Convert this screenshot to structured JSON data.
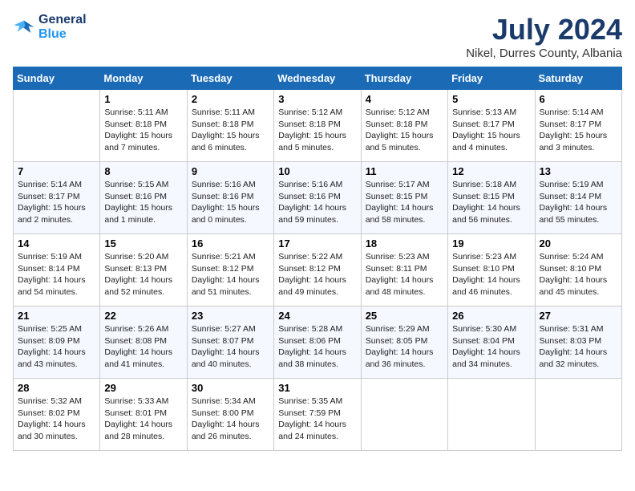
{
  "header": {
    "logo_line1": "General",
    "logo_line2": "Blue",
    "month": "July 2024",
    "location": "Nikel, Durres County, Albania"
  },
  "weekdays": [
    "Sunday",
    "Monday",
    "Tuesday",
    "Wednesday",
    "Thursday",
    "Friday",
    "Saturday"
  ],
  "weeks": [
    [
      {
        "day": "",
        "info": ""
      },
      {
        "day": "1",
        "info": "Sunrise: 5:11 AM\nSunset: 8:18 PM\nDaylight: 15 hours\nand 7 minutes."
      },
      {
        "day": "2",
        "info": "Sunrise: 5:11 AM\nSunset: 8:18 PM\nDaylight: 15 hours\nand 6 minutes."
      },
      {
        "day": "3",
        "info": "Sunrise: 5:12 AM\nSunset: 8:18 PM\nDaylight: 15 hours\nand 5 minutes."
      },
      {
        "day": "4",
        "info": "Sunrise: 5:12 AM\nSunset: 8:18 PM\nDaylight: 15 hours\nand 5 minutes."
      },
      {
        "day": "5",
        "info": "Sunrise: 5:13 AM\nSunset: 8:17 PM\nDaylight: 15 hours\nand 4 minutes."
      },
      {
        "day": "6",
        "info": "Sunrise: 5:14 AM\nSunset: 8:17 PM\nDaylight: 15 hours\nand 3 minutes."
      }
    ],
    [
      {
        "day": "7",
        "info": "Sunrise: 5:14 AM\nSunset: 8:17 PM\nDaylight: 15 hours\nand 2 minutes."
      },
      {
        "day": "8",
        "info": "Sunrise: 5:15 AM\nSunset: 8:16 PM\nDaylight: 15 hours\nand 1 minute."
      },
      {
        "day": "9",
        "info": "Sunrise: 5:16 AM\nSunset: 8:16 PM\nDaylight: 15 hours\nand 0 minutes."
      },
      {
        "day": "10",
        "info": "Sunrise: 5:16 AM\nSunset: 8:16 PM\nDaylight: 14 hours\nand 59 minutes."
      },
      {
        "day": "11",
        "info": "Sunrise: 5:17 AM\nSunset: 8:15 PM\nDaylight: 14 hours\nand 58 minutes."
      },
      {
        "day": "12",
        "info": "Sunrise: 5:18 AM\nSunset: 8:15 PM\nDaylight: 14 hours\nand 56 minutes."
      },
      {
        "day": "13",
        "info": "Sunrise: 5:19 AM\nSunset: 8:14 PM\nDaylight: 14 hours\nand 55 minutes."
      }
    ],
    [
      {
        "day": "14",
        "info": "Sunrise: 5:19 AM\nSunset: 8:14 PM\nDaylight: 14 hours\nand 54 minutes."
      },
      {
        "day": "15",
        "info": "Sunrise: 5:20 AM\nSunset: 8:13 PM\nDaylight: 14 hours\nand 52 minutes."
      },
      {
        "day": "16",
        "info": "Sunrise: 5:21 AM\nSunset: 8:12 PM\nDaylight: 14 hours\nand 51 minutes."
      },
      {
        "day": "17",
        "info": "Sunrise: 5:22 AM\nSunset: 8:12 PM\nDaylight: 14 hours\nand 49 minutes."
      },
      {
        "day": "18",
        "info": "Sunrise: 5:23 AM\nSunset: 8:11 PM\nDaylight: 14 hours\nand 48 minutes."
      },
      {
        "day": "19",
        "info": "Sunrise: 5:23 AM\nSunset: 8:10 PM\nDaylight: 14 hours\nand 46 minutes."
      },
      {
        "day": "20",
        "info": "Sunrise: 5:24 AM\nSunset: 8:10 PM\nDaylight: 14 hours\nand 45 minutes."
      }
    ],
    [
      {
        "day": "21",
        "info": "Sunrise: 5:25 AM\nSunset: 8:09 PM\nDaylight: 14 hours\nand 43 minutes."
      },
      {
        "day": "22",
        "info": "Sunrise: 5:26 AM\nSunset: 8:08 PM\nDaylight: 14 hours\nand 41 minutes."
      },
      {
        "day": "23",
        "info": "Sunrise: 5:27 AM\nSunset: 8:07 PM\nDaylight: 14 hours\nand 40 minutes."
      },
      {
        "day": "24",
        "info": "Sunrise: 5:28 AM\nSunset: 8:06 PM\nDaylight: 14 hours\nand 38 minutes."
      },
      {
        "day": "25",
        "info": "Sunrise: 5:29 AM\nSunset: 8:05 PM\nDaylight: 14 hours\nand 36 minutes."
      },
      {
        "day": "26",
        "info": "Sunrise: 5:30 AM\nSunset: 8:04 PM\nDaylight: 14 hours\nand 34 minutes."
      },
      {
        "day": "27",
        "info": "Sunrise: 5:31 AM\nSunset: 8:03 PM\nDaylight: 14 hours\nand 32 minutes."
      }
    ],
    [
      {
        "day": "28",
        "info": "Sunrise: 5:32 AM\nSunset: 8:02 PM\nDaylight: 14 hours\nand 30 minutes."
      },
      {
        "day": "29",
        "info": "Sunrise: 5:33 AM\nSunset: 8:01 PM\nDaylight: 14 hours\nand 28 minutes."
      },
      {
        "day": "30",
        "info": "Sunrise: 5:34 AM\nSunset: 8:00 PM\nDaylight: 14 hours\nand 26 minutes."
      },
      {
        "day": "31",
        "info": "Sunrise: 5:35 AM\nSunset: 7:59 PM\nDaylight: 14 hours\nand 24 minutes."
      },
      {
        "day": "",
        "info": ""
      },
      {
        "day": "",
        "info": ""
      },
      {
        "day": "",
        "info": ""
      }
    ]
  ]
}
